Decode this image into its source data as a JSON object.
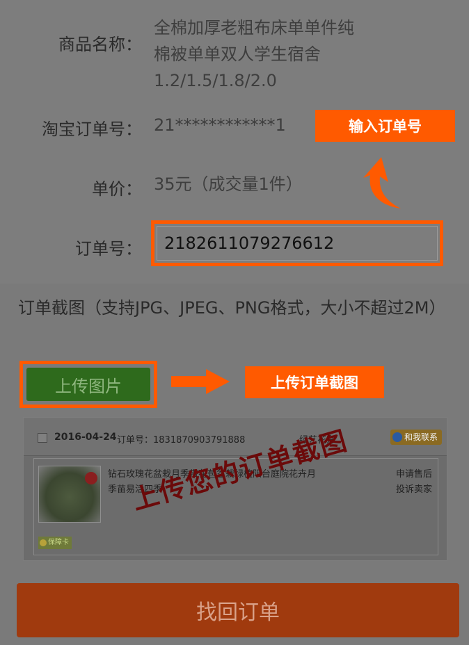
{
  "product": {
    "label": "商品名称：",
    "lines": [
      "全棉加厚老粗布床单单件纯",
      "棉被单单双人学生宿舍",
      "1.2/1.5/1.8/2.0"
    ]
  },
  "taobao_order": {
    "label": "淘宝订单号：",
    "value": "21************1"
  },
  "unit_price": {
    "label": "单价：",
    "value": "35元（成交量1件）"
  },
  "order_no": {
    "label": "订单号：",
    "value": "2182611079276612"
  },
  "callouts": {
    "enter_order": "输入订单号",
    "upload_screenshot": "上传订单截图"
  },
  "screenshot_section": {
    "title": "订单截图（支持JPG、JPEG、PNG格式，大小不超过2M）",
    "upload_button": "上传图片"
  },
  "example": {
    "date": "2016-04-24",
    "order_label": "订单号：1831870903791888",
    "shop": "绿艺花卉",
    "contact": "和我联系",
    "item_title": "钻石玫瑰花盆栽月季带花苞盆栽绿植阳台庭院花卉月季苗易活四季",
    "after_sale": [
      "申请售后",
      "投诉卖家"
    ],
    "badge": "保障卡",
    "watermark": "上传您的订单截图"
  },
  "submit_button": "找回订单",
  "colors": {
    "accent": "#ff5a00",
    "upload_green": "#2e6a1c",
    "submit": "#a03a0e",
    "overlay_gray": "#7a7a7a"
  }
}
